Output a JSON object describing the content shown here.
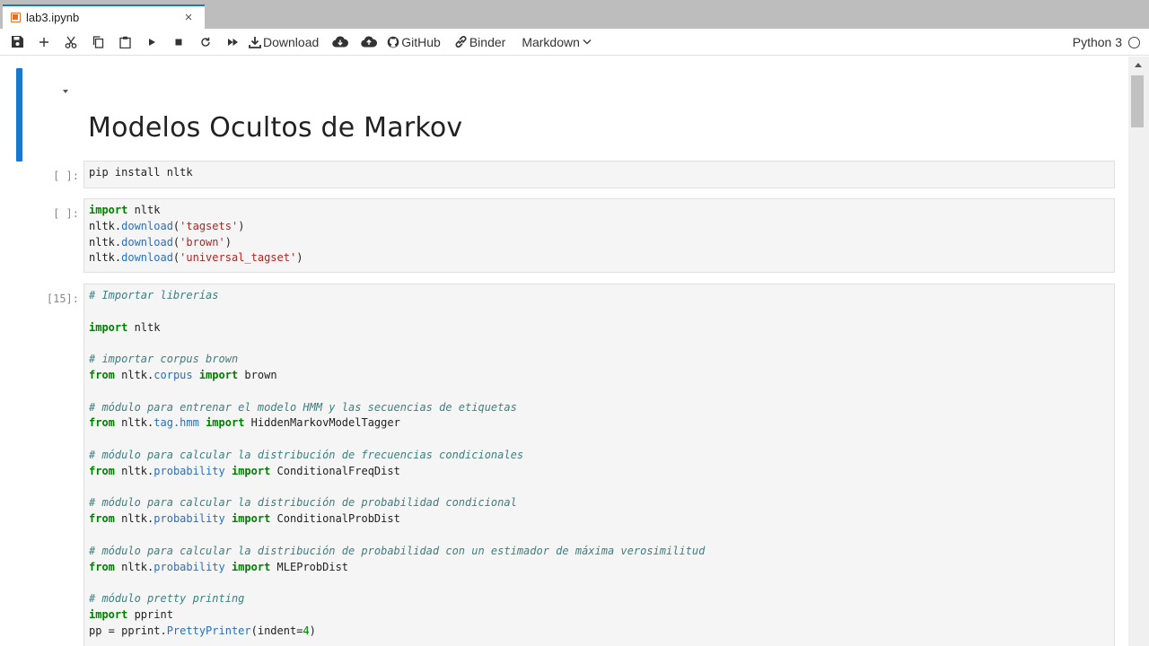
{
  "tab": {
    "title": "lab3.ipynb",
    "close": "×"
  },
  "toolbar": {
    "download_label": "Download",
    "github_label": "GitHub",
    "binder_label": "Binder",
    "cell_type": "Markdown",
    "kernel_name": "Python 3"
  },
  "notebook": {
    "heading": "Modelos Ocultos de Markov",
    "cells": [
      {
        "prompt": "[ ]:"
      },
      {
        "prompt": "[ ]:"
      },
      {
        "prompt": "[15]:"
      }
    ]
  },
  "code": {
    "c1": {
      "l1": "pip install nltk"
    },
    "c2": {
      "l1_kw": "import",
      "l1_rest": " nltk",
      "l2_a": "nltk.",
      "l2_fn": "download",
      "l2_b": "(",
      "l2_str": "'tagsets'",
      "l2_c": ")",
      "l3_a": "nltk.",
      "l3_fn": "download",
      "l3_b": "(",
      "l3_str": "'brown'",
      "l3_c": ")",
      "l4_a": "nltk.",
      "l4_fn": "download",
      "l4_b": "(",
      "l4_str": "'universal_tagset'",
      "l4_c": ")"
    },
    "c3": {
      "cm1": "# Importar librerías",
      "imp1_kw": "import",
      "imp1_rest": " nltk",
      "cm2": "# importar corpus brown",
      "f2_from": "from",
      "f2_mod_a": " nltk.",
      "f2_mod_b": "corpus",
      "f2_imp": " import",
      "f2_name": " brown",
      "cm3": "# módulo para entrenar el modelo HMM y las secuencias de etiquetas",
      "f3_from": "from",
      "f3_mod_a": " nltk.",
      "f3_mod_b": "tag.hmm",
      "f3_imp": " import",
      "f3_name": " HiddenMarkovModelTagger",
      "cm4": "# módulo para calcular la distribución de frecuencias condicionales",
      "f4_from": "from",
      "f4_mod_a": " nltk.",
      "f4_mod_b": "probability",
      "f4_imp": " import",
      "f4_name": " ConditionalFreqDist",
      "cm5": "# módulo para calcular la distribución de probabilidad condicional",
      "f5_from": "from",
      "f5_mod_a": " nltk.",
      "f5_mod_b": "probability",
      "f5_imp": " import",
      "f5_name": " ConditionalProbDist",
      "cm6": "# módulo para calcular la distribución de probabilidad con un estimador de máxima verosimilitud",
      "f6_from": "from",
      "f6_mod_a": " nltk.",
      "f6_mod_b": "probability",
      "f6_imp": " import",
      "f6_name": " MLEProbDist",
      "cm7": "# módulo pretty printing",
      "imp7_kw": "import",
      "imp7_rest": " pprint",
      "pp_a": "pp = pprint.",
      "pp_fn": "PrettyPrinter",
      "pp_b": "(indent=",
      "pp_num": "4",
      "pp_c": ")"
    }
  },
  "colors": {
    "accent": "#1976d2",
    "keyword": "#008000",
    "string": "#ba2121",
    "comment": "#408080"
  }
}
